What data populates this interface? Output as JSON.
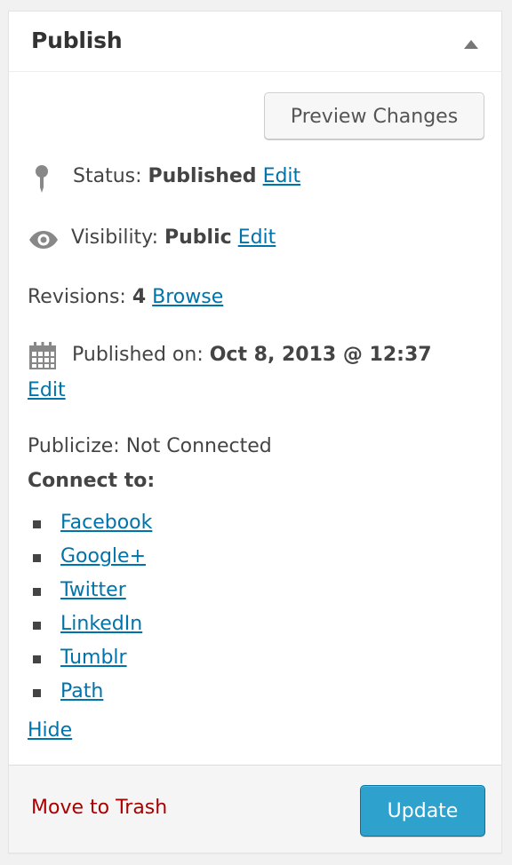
{
  "header": {
    "title": "Publish"
  },
  "actions": {
    "preview_label": "Preview Changes"
  },
  "status": {
    "label": "Status:",
    "value": "Published",
    "edit_label": "Edit"
  },
  "visibility": {
    "label": "Visibility:",
    "value": "Public",
    "edit_label": "Edit"
  },
  "revisions": {
    "label": "Revisions:",
    "value": "4",
    "browse_label": "Browse"
  },
  "published": {
    "label": "Published on:",
    "value": "Oct 8, 2013 @ 12:37",
    "edit_label": "Edit"
  },
  "publicize": {
    "status_text": "Publicize: Not Connected",
    "connect_label": "Connect to:",
    "services": [
      "Facebook",
      "Google+",
      "Twitter",
      "LinkedIn",
      "Tumblr",
      "Path"
    ],
    "hide_label": "Hide"
  },
  "footer": {
    "trash_label": "Move to Trash",
    "update_label": "Update"
  },
  "colors": {
    "link": "#0073aa",
    "trash": "#aa0000",
    "primary_button": "#2ea2cc"
  }
}
